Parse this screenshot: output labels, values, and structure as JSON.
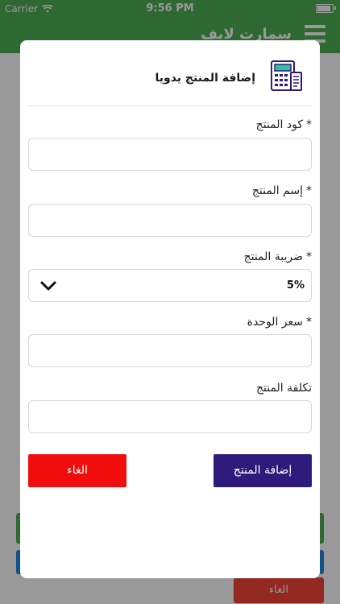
{
  "status_bar": {
    "carrier": "Carrier",
    "time": "9:56 PM"
  },
  "app": {
    "title": "سمارت لايف",
    "background_cancel": "الغاء"
  },
  "modal": {
    "title": "إضافة المنتج يدويا",
    "icon": "calculator-receipt-icon",
    "required_mark": "*",
    "fields": {
      "code": {
        "label": "كود المنتج",
        "value": "",
        "required": true
      },
      "name": {
        "label": "إسم المنتج",
        "value": "",
        "required": true
      },
      "tax": {
        "label": "ضريبة المنتج",
        "selected": "5%",
        "required": true
      },
      "unit_price": {
        "label": "سعر الوحدة",
        "value": "",
        "required": true
      },
      "cost": {
        "label": "تكلفة المنتج",
        "value": "",
        "required": false
      }
    },
    "buttons": {
      "add": "إضافة المنتج",
      "cancel": "الغاء"
    }
  },
  "colors": {
    "app_bar": "#4caf50",
    "add_button": "#2e1a7a",
    "cancel_button": "#f20d0d",
    "icon_accent": "#2e1a7a",
    "icon_screen": "#2ec4a0"
  }
}
